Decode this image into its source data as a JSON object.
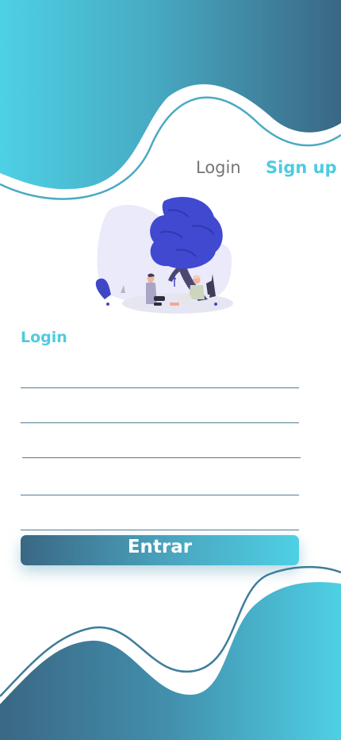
{
  "nav": {
    "login_label": "Login",
    "signup_label": "Sign up"
  },
  "form": {
    "title": "Login",
    "submit_label": "Entrar"
  },
  "icons": {
    "illustration": "people-under-tree-illustration"
  },
  "colors": {
    "accent": "#4ecbe0",
    "gradient_dark": "#3a6784",
    "gradient_light": "#4ed0e4",
    "nav_inactive": "#757575",
    "underline": "#4f7d96"
  }
}
